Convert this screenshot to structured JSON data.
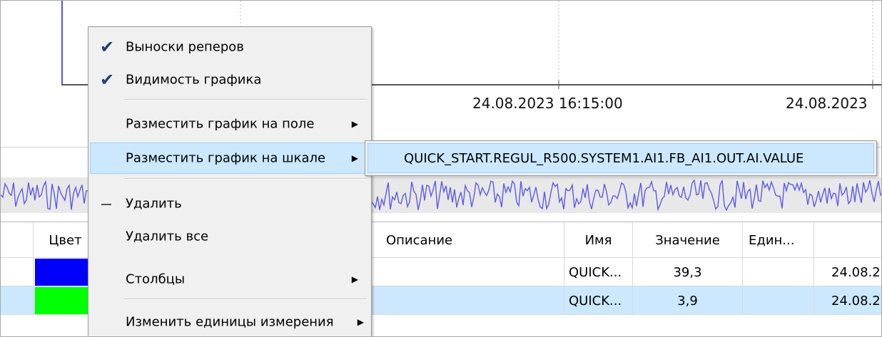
{
  "plot": {
    "time_labels": [
      "24.08.2023 16:15:00",
      "24.08.2023"
    ],
    "series_color": "#5555dd"
  },
  "overview": {
    "series_color": "#5b5be8",
    "background": "#e8e8e8"
  },
  "table": {
    "columns": [
      "Цвет",
      "Описание",
      "Имя",
      "Значение",
      "Един...",
      ""
    ],
    "rows": [
      {
        "color": "#0000ff",
        "description": "",
        "name": "QUICK...",
        "value": "39,3",
        "unit": "",
        "time": "24.08.2"
      },
      {
        "color": "#00ff00",
        "description": "",
        "name": "QUICK...",
        "value": "3,9",
        "unit": "",
        "time": "24.08.2"
      }
    ]
  },
  "context_menu": {
    "items": [
      {
        "label": "Выноски реперов",
        "checked": true
      },
      {
        "label": "Видимость графика",
        "checked": true
      },
      {
        "label": "Разместить график на поле",
        "submenu": true
      },
      {
        "label": "Разместить график на шкале",
        "submenu": true,
        "highlighted": true
      },
      {
        "label": "Удалить",
        "icon": "minus-icon"
      },
      {
        "label": "Удалить все"
      },
      {
        "label": "Столбцы",
        "submenu": true
      },
      {
        "label": "Изменить единицы измерения",
        "submenu": true
      }
    ]
  },
  "submenu": {
    "item": "QUICK_START.REGUL_R500.SYSTEM1.AI1.FB_AI1.OUT.AI.VALUE"
  },
  "colors": {
    "highlight": "#cce8ff",
    "menu_bg": "#f0f0f0"
  }
}
